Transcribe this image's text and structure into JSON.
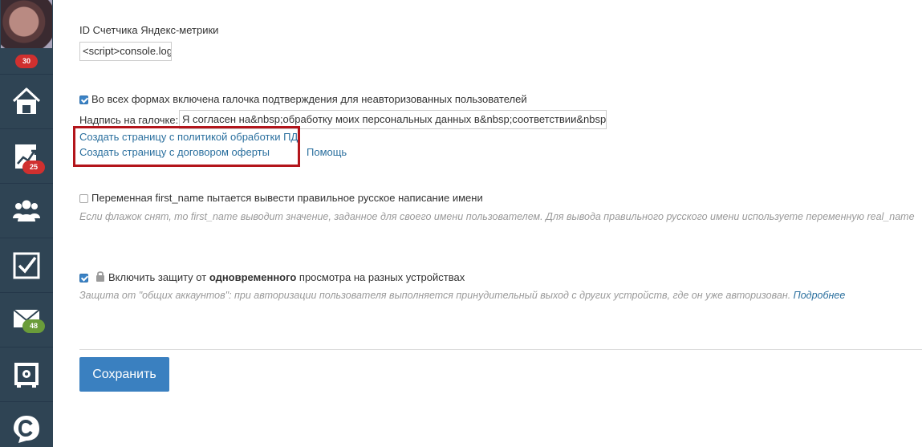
{
  "sidebar": {
    "avatar_badge": "30",
    "items": [
      {
        "name": "home",
        "badge": null
      },
      {
        "name": "analytics",
        "badge": "25",
        "badge_color": "#d0302f"
      },
      {
        "name": "users",
        "badge": null
      },
      {
        "name": "tasks",
        "badge": null
      },
      {
        "name": "messages",
        "badge": "48",
        "badge_color": "#6a9c3a"
      },
      {
        "name": "safe",
        "badge": null
      },
      {
        "name": "brand",
        "badge": null
      }
    ]
  },
  "metrika": {
    "label": "ID Счетчика Яндекс-метрики",
    "value": "<script>console.log("
  },
  "consent": {
    "checkbox_label": "Во всех формах включена галочка подтверждения для неавторизованных пользователей",
    "checked": true,
    "caption_label": "Надпись на галочке:",
    "caption_value": "Я согласен на&nbsp;обработку моих персональных данных в&nbsp;соответствии&nbsp;с&",
    "link_privacy": "Создать страницу с политикой обработки ПД",
    "link_offer": "Создать страницу с договором оферты",
    "link_help": "Помощь"
  },
  "first_name": {
    "checkbox_label": "Переменная first_name пытается вывести правильное русское написание имени",
    "checked": false,
    "hint": "Если флажок снят, то first_name выводит значение, заданное для своего имени пользователем. Для вывода правильного русского имени используете переменную real_name"
  },
  "protection": {
    "label_before": "Включить защиту от ",
    "label_bold": "одновременного",
    "label_after": " просмотра на разных устройствах",
    "checked": true,
    "hint": "Защита от \"общих аккаунтов\": при авторизации пользователя выполняется принудительный выход с других устройств, где он уже авторизован.",
    "hint_link": "Подробнее"
  },
  "actions": {
    "save_label": "Сохранить"
  },
  "colors": {
    "sidebar": "#2f4454",
    "link": "#2a6f9e",
    "primary_button": "#3a80c0",
    "highlight": "#b3151b",
    "badge_red": "#d0302f",
    "badge_green": "#6a9c3a"
  }
}
